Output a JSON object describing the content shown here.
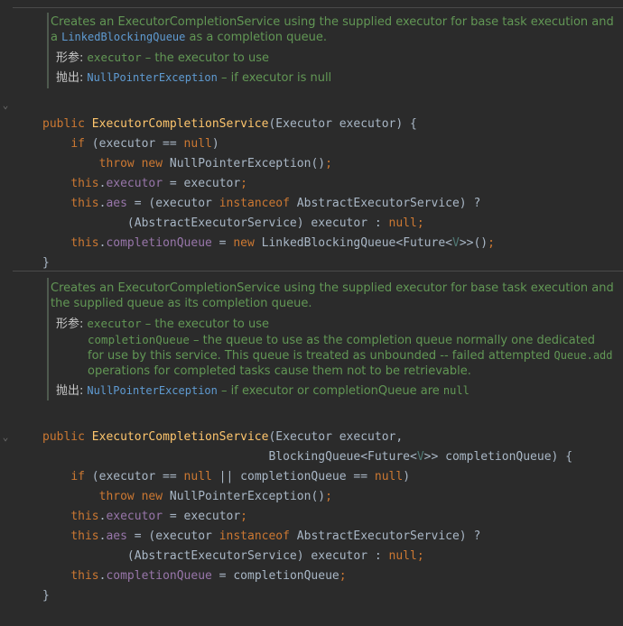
{
  "block1": {
    "doc": {
      "desc1": "Creates an ExecutorCompletionService using the supplied executor for base task execution and a ",
      "desc_link": "LinkedBlockingQueue",
      "desc2": " as a completion queue.",
      "param_tag": "形参:",
      "param_name": "executor",
      "param_desc": " – the executor to use",
      "throws_tag": "抛出:",
      "throws_link": "NullPointerException",
      "throws_desc": " – if executor is null"
    },
    "code": {
      "l1_public": "public ",
      "l1_name": "ExecutorCompletionService",
      "l1_rest": "(Executor executor) {",
      "l2_if": "if",
      "l2_a": " (executor == ",
      "l2_null": "null",
      "l2_b": ")",
      "l3_throw": "throw ",
      "l3_new": "new ",
      "l3_rest": "NullPointerException()",
      "l3_semi": ";",
      "l4_this": "this",
      "l4_dot": ".",
      "l4_field": "executor",
      "l4_rest": " = executor",
      "l4_semi": ";",
      "l5_this": "this",
      "l5_dot": ".",
      "l5_field": "aes",
      "l5_a": " = (executor ",
      "l5_inst": "instanceof",
      "l5_b": " AbstractExecutorService) ?",
      "l6_a": "(AbstractExecutorService) executor : ",
      "l6_null": "null",
      "l6_semi": ";",
      "l7_this": "this",
      "l7_dot": ".",
      "l7_field": "completionQueue",
      "l7_a": " = ",
      "l7_new": "new ",
      "l7_b": "LinkedBlockingQueue<Future<",
      "l7_v": "V",
      "l7_c": ">>()",
      "l7_semi": ";",
      "l8": "}"
    }
  },
  "block2": {
    "doc": {
      "desc": "Creates an ExecutorCompletionService using the supplied executor for base task execution and the supplied queue as its completion queue.",
      "param_tag": "形参:",
      "p1_name": "executor",
      "p1_desc": " – the executor to use",
      "p2_name": "completionQueue",
      "p2_desc": " – the queue to use as the completion queue normally one dedicated for use by this service. This queue is treated as unbounded -- failed attempted ",
      "p2_code": "Queue.add",
      "p2_desc2": " operations for completed tasks cause them not to be retrievable.",
      "throws_tag": "抛出:",
      "throws_link": "NullPointerException",
      "throws_desc": " – if executor or completionQueue are ",
      "throws_null": "null"
    },
    "code": {
      "l1_public": "public ",
      "l1_name": "ExecutorCompletionService",
      "l1_rest": "(Executor executor,",
      "l2_a": "BlockingQueue<Future<",
      "l2_v": "V",
      "l2_b": ">> completionQueue) {",
      "l3_if": "if",
      "l3_a": " (executor == ",
      "l3_null1": "null",
      "l3_b": " || completionQueue == ",
      "l3_null2": "null",
      "l3_c": ")",
      "l4_throw": "throw ",
      "l4_new": "new ",
      "l4_rest": "NullPointerException()",
      "l4_semi": ";",
      "l5_this": "this",
      "l5_dot": ".",
      "l5_field": "executor",
      "l5_rest": " = executor",
      "l5_semi": ";",
      "l6_this": "this",
      "l6_dot": ".",
      "l6_field": "aes",
      "l6_a": " = (executor ",
      "l6_inst": "instanceof",
      "l6_b": " AbstractExecutorService) ?",
      "l7_a": "(AbstractExecutorService) executor : ",
      "l7_null": "null",
      "l7_semi": ";",
      "l8_this": "this",
      "l8_dot": ".",
      "l8_field": "completionQueue",
      "l8_rest": " = completionQueue",
      "l8_semi": ";",
      "l9": "}"
    }
  },
  "gutter": {
    "fold_glyph": "⌄"
  }
}
